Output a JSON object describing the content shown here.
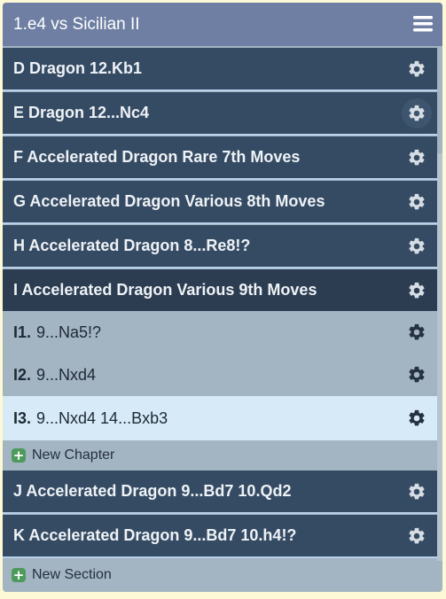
{
  "header": {
    "title": "1.e4 vs Sicilian II"
  },
  "sections_top": [
    {
      "label": "D Dragon 12.Kb1"
    },
    {
      "label": "E Dragon 12...Nc4"
    },
    {
      "label": "F Accelerated Dragon Rare 7th Moves"
    },
    {
      "label": "G Accelerated Dragon Various 8th Moves"
    },
    {
      "label": "H Accelerated Dragon 8...Re8!?"
    },
    {
      "label": "I Accelerated Dragon Various 9th Moves"
    }
  ],
  "chapters": [
    {
      "num": "I1.",
      "label": "9...Na5!?"
    },
    {
      "num": "I2.",
      "label": "9...Nxd4"
    },
    {
      "num": "I3.",
      "label": "9...Nxd4 14...Bxb3"
    }
  ],
  "new_chapter": "New Chapter",
  "sections_bottom": [
    {
      "label": "J Accelerated Dragon 9...Bd7 10.Qd2"
    },
    {
      "label": "K Accelerated Dragon 9...Bd7 10.h4!?"
    }
  ],
  "new_section": "New Section",
  "colors": {
    "header": "#6e7fa3",
    "section": "#354b63",
    "chapter": "#a3b4c2",
    "selected": "#d7eaf8",
    "plus": "#4e9a5c"
  },
  "icons": {
    "menu": "hamburger-menu-icon",
    "settings": "gear-icon",
    "add": "plus-icon"
  }
}
